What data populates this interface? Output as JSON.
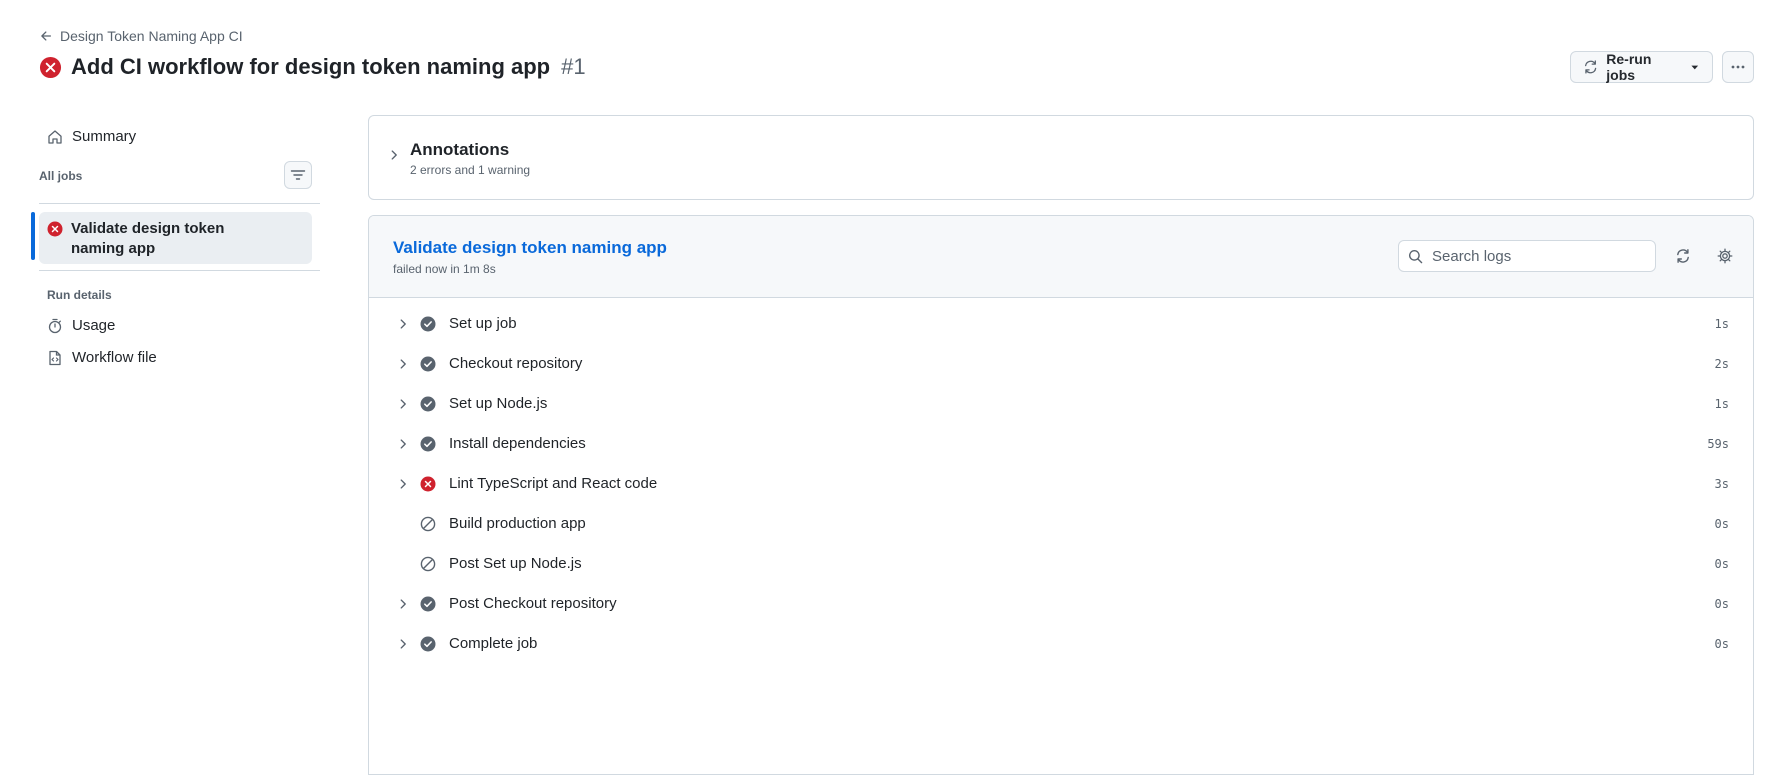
{
  "header": {
    "back_label": "Design Token Naming App CI",
    "title": "Add CI workflow for design token naming app",
    "run_number": "#1",
    "rerun_label": "Re-run jobs"
  },
  "sidebar": {
    "summary_label": "Summary",
    "all_jobs_label": "All jobs",
    "jobs": [
      {
        "label": "Validate design token naming app",
        "status": "failure"
      }
    ],
    "run_details_label": "Run details",
    "usage_label": "Usage",
    "workflow_file_label": "Workflow file"
  },
  "annotations": {
    "title": "Annotations",
    "subtitle": "2 errors and 1 warning"
  },
  "job": {
    "title": "Validate design token naming app",
    "subtitle": "failed now in 1m 8s",
    "search_placeholder": "Search logs",
    "steps": [
      {
        "name": "Set up job",
        "duration": "1s",
        "status": "success",
        "expandable": true
      },
      {
        "name": "Checkout repository",
        "duration": "2s",
        "status": "success",
        "expandable": true
      },
      {
        "name": "Set up Node.js",
        "duration": "1s",
        "status": "success",
        "expandable": true
      },
      {
        "name": "Install dependencies",
        "duration": "59s",
        "status": "success",
        "expandable": true
      },
      {
        "name": "Lint TypeScript and React code",
        "duration": "3s",
        "status": "failure",
        "expandable": true
      },
      {
        "name": "Build production app",
        "duration": "0s",
        "status": "skipped",
        "expandable": false
      },
      {
        "name": "Post Set up Node.js",
        "duration": "0s",
        "status": "skipped",
        "expandable": false
      },
      {
        "name": "Post Checkout repository",
        "duration": "0s",
        "status": "success",
        "expandable": true
      },
      {
        "name": "Complete job",
        "duration": "0s",
        "status": "success",
        "expandable": true
      }
    ]
  },
  "colors": {
    "failure": "#cf222e",
    "success": "#59636e",
    "link": "#0969da",
    "accent_bar": "#0969da"
  }
}
